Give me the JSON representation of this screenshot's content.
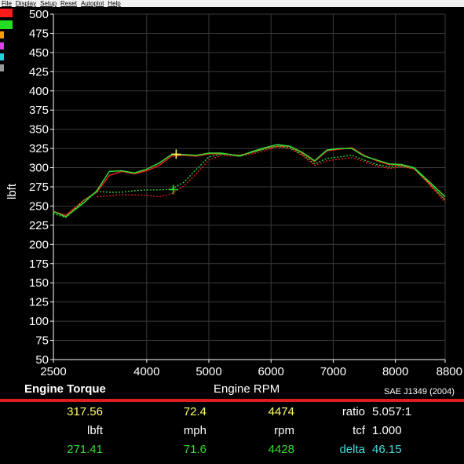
{
  "menu": [
    "File",
    "Display",
    "Setup",
    "Reset",
    "Autoplot",
    "Help"
  ],
  "swatch_colors": [
    "#ff1a1a",
    "#22dd22",
    "#ff9900",
    "#e040e0",
    "#22d0e0",
    "#999999"
  ],
  "colors": {
    "red": "#e82020",
    "green": "#33dd33",
    "yellow": "#ffff66",
    "cyan": "#44dddd",
    "white": "#ffffff",
    "grid": "#3a3a3a"
  },
  "chart_data": {
    "type": "line",
    "title": "Engine Torque",
    "xlabel": "Engine RPM",
    "ylabel": "lbft",
    "standard": "SAE J1349 (2004)",
    "xlim": [
      2500,
      8800
    ],
    "ylim": [
      50,
      500
    ],
    "x_ticks": [
      2500,
      4000,
      5000,
      6000,
      7000,
      8000,
      8800
    ],
    "y_ticks": [
      50,
      75,
      100,
      125,
      150,
      175,
      200,
      225,
      250,
      275,
      300,
      325,
      350,
      375,
      400,
      425,
      450,
      475,
      500
    ],
    "grid": true,
    "series": [
      {
        "color": "#e82020",
        "style": "solid",
        "points": [
          [
            2500,
            243
          ],
          [
            2700,
            238
          ],
          [
            3000,
            258
          ],
          [
            3200,
            268
          ],
          [
            3400,
            290
          ],
          [
            3600,
            295
          ],
          [
            3800,
            292
          ],
          [
            4000,
            296
          ],
          [
            4200,
            303
          ],
          [
            4400,
            315
          ],
          [
            4600,
            316
          ],
          [
            4800,
            315
          ],
          [
            5000,
            318
          ],
          [
            5200,
            318
          ],
          [
            5500,
            316
          ],
          [
            5700,
            320
          ],
          [
            5900,
            325
          ],
          [
            6100,
            328
          ],
          [
            6300,
            328
          ],
          [
            6500,
            319
          ],
          [
            6700,
            308
          ],
          [
            6900,
            322
          ],
          [
            7100,
            324
          ],
          [
            7300,
            326
          ],
          [
            7500,
            316
          ],
          [
            7700,
            309
          ],
          [
            7900,
            304
          ],
          [
            8100,
            303
          ],
          [
            8300,
            299
          ],
          [
            8500,
            283
          ],
          [
            8800,
            258
          ]
        ]
      },
      {
        "color": "#e82020",
        "style": "dotted",
        "points": [
          [
            3200,
            262
          ],
          [
            3600,
            265
          ],
          [
            4000,
            264
          ],
          [
            4200,
            262
          ],
          [
            4400,
            266
          ],
          [
            4600,
            276
          ],
          [
            4800,
            292
          ],
          [
            5000,
            310
          ],
          [
            5200,
            316
          ],
          [
            5500,
            315
          ],
          [
            5700,
            318
          ],
          [
            5900,
            322
          ],
          [
            6100,
            327
          ],
          [
            6300,
            325
          ],
          [
            6500,
            316
          ],
          [
            6700,
            303
          ],
          [
            6900,
            309
          ],
          [
            7100,
            311
          ],
          [
            7300,
            313
          ],
          [
            7500,
            308
          ],
          [
            7700,
            302
          ],
          [
            7900,
            299
          ],
          [
            8100,
            301
          ],
          [
            8300,
            298
          ],
          [
            8500,
            282
          ],
          [
            8800,
            255
          ]
        ]
      },
      {
        "color": "#33dd33",
        "style": "solid",
        "points": [
          [
            2500,
            243
          ],
          [
            2700,
            236
          ],
          [
            3000,
            255
          ],
          [
            3200,
            270
          ],
          [
            3400,
            295
          ],
          [
            3600,
            296
          ],
          [
            3800,
            293
          ],
          [
            4000,
            298
          ],
          [
            4200,
            306
          ],
          [
            4400,
            317
          ],
          [
            4600,
            317
          ],
          [
            4800,
            316
          ],
          [
            5000,
            319
          ],
          [
            5200,
            319
          ],
          [
            5500,
            315
          ],
          [
            5700,
            321
          ],
          [
            5900,
            326
          ],
          [
            6100,
            330
          ],
          [
            6300,
            328
          ],
          [
            6500,
            320
          ],
          [
            6700,
            309
          ],
          [
            6900,
            323
          ],
          [
            7100,
            325
          ],
          [
            7300,
            325
          ],
          [
            7500,
            315
          ],
          [
            7700,
            310
          ],
          [
            7900,
            305
          ],
          [
            8100,
            304
          ],
          [
            8300,
            300
          ],
          [
            8500,
            285
          ],
          [
            8800,
            262
          ]
        ]
      },
      {
        "color": "#33dd33",
        "style": "dotted",
        "points": [
          [
            2500,
            240
          ],
          [
            2700,
            235
          ],
          [
            3000,
            258
          ],
          [
            3200,
            269
          ],
          [
            3400,
            268
          ],
          [
            3600,
            268
          ],
          [
            3800,
            270
          ],
          [
            4000,
            271
          ],
          [
            4200,
            271
          ],
          [
            4400,
            272
          ],
          [
            4600,
            281
          ],
          [
            4800,
            298
          ],
          [
            5000,
            314
          ],
          [
            5200,
            318
          ],
          [
            5500,
            316
          ],
          [
            5700,
            320
          ],
          [
            5900,
            324
          ],
          [
            6100,
            328
          ],
          [
            6300,
            326
          ],
          [
            6500,
            317
          ],
          [
            6700,
            305
          ],
          [
            6900,
            312
          ],
          [
            7100,
            314
          ],
          [
            7300,
            316
          ],
          [
            7500,
            310
          ],
          [
            7700,
            304
          ],
          [
            7900,
            301
          ],
          [
            8100,
            302
          ],
          [
            8300,
            299
          ],
          [
            8500,
            283
          ],
          [
            8800,
            258
          ]
        ]
      }
    ],
    "cursors": [
      {
        "rpm": 4474,
        "value": 317.56,
        "color": "#ffff66"
      },
      {
        "rpm": 4428,
        "value": 271.41,
        "color": "#33dd33"
      }
    ]
  },
  "readout": {
    "yellow_lbft": "317.56",
    "yellow_mph": "72.4",
    "yellow_rpm": "4474",
    "unit_lbft": "lbft",
    "unit_mph": "mph",
    "unit_rpm": "rpm",
    "green_lbft": "271.41",
    "green_mph": "71.6",
    "green_rpm": "4428",
    "ratio_label": "ratio",
    "ratio_value": "5.057:1",
    "tcf_label": "tcf",
    "tcf_value": "1.000",
    "delta_label": "delta",
    "delta_value": "46.15"
  }
}
